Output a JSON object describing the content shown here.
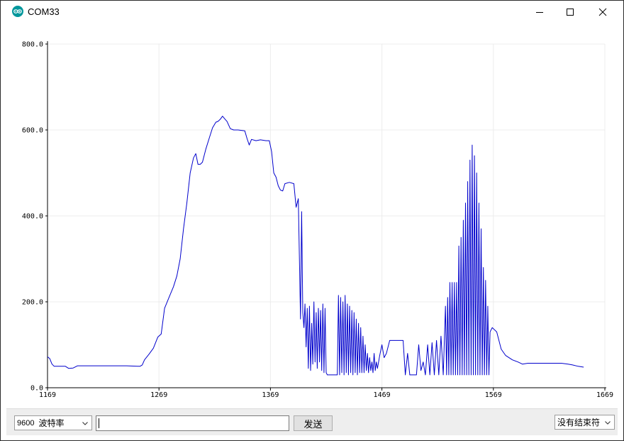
{
  "window": {
    "title": "COM33",
    "app_icon": "arduino-icon",
    "controls": [
      "minimize-icon",
      "maximize-icon",
      "close-icon"
    ]
  },
  "chart_data": {
    "type": "line",
    "title": "",
    "xlabel": "",
    "ylabel": "",
    "xlim": [
      1169,
      1669
    ],
    "ylim": [
      0,
      800
    ],
    "x_ticks": [
      "1169",
      "1269",
      "1369",
      "1469",
      "1569",
      "1669"
    ],
    "y_ticks": [
      "0.0",
      "200.0",
      "400.0",
      "600.0",
      "800.0"
    ],
    "grid": true,
    "series": [
      {
        "color": "#0000cc",
        "points": [
          [
            1169,
            72
          ],
          [
            1171,
            68
          ],
          [
            1173,
            55
          ],
          [
            1175,
            50
          ],
          [
            1178,
            50
          ],
          [
            1185,
            50
          ],
          [
            1188,
            45
          ],
          [
            1192,
            46
          ],
          [
            1196,
            51
          ],
          [
            1210,
            51
          ],
          [
            1240,
            51
          ],
          [
            1250,
            50
          ],
          [
            1252,
            50
          ],
          [
            1254,
            53
          ],
          [
            1256,
            65
          ],
          [
            1260,
            78
          ],
          [
            1264,
            92
          ],
          [
            1268,
            118
          ],
          [
            1271,
            125
          ],
          [
            1274,
            185
          ],
          [
            1278,
            210
          ],
          [
            1282,
            235
          ],
          [
            1285,
            260
          ],
          [
            1288,
            300
          ],
          [
            1291,
            370
          ],
          [
            1294,
            430
          ],
          [
            1297,
            500
          ],
          [
            1300,
            535
          ],
          [
            1302,
            545
          ],
          [
            1304,
            520
          ],
          [
            1306,
            520
          ],
          [
            1308,
            525
          ],
          [
            1311,
            555
          ],
          [
            1314,
            580
          ],
          [
            1317,
            605
          ],
          [
            1320,
            618
          ],
          [
            1322,
            620
          ],
          [
            1324,
            625
          ],
          [
            1326,
            632
          ],
          [
            1328,
            626
          ],
          [
            1330,
            620
          ],
          [
            1333,
            603
          ],
          [
            1336,
            600
          ],
          [
            1340,
            600
          ],
          [
            1346,
            598
          ],
          [
            1348,
            580
          ],
          [
            1350,
            565
          ],
          [
            1352,
            578
          ],
          [
            1356,
            575
          ],
          [
            1360,
            577
          ],
          [
            1365,
            575
          ],
          [
            1368,
            575
          ],
          [
            1370,
            550
          ],
          [
            1372,
            500
          ],
          [
            1374,
            490
          ],
          [
            1376,
            470
          ],
          [
            1378,
            460
          ],
          [
            1380,
            458
          ],
          [
            1382,
            475
          ],
          [
            1386,
            478
          ],
          [
            1390,
            475
          ],
          [
            1392,
            420
          ],
          [
            1394,
            440
          ],
          [
            1396,
            160
          ],
          [
            1397,
            410
          ],
          [
            1398,
            175
          ],
          [
            1399,
            140
          ],
          [
            1400,
            195
          ],
          [
            1401,
            95
          ],
          [
            1402,
            185
          ],
          [
            1403,
            45
          ],
          [
            1404,
            190
          ],
          [
            1405,
            40
          ],
          [
            1406,
            150
          ],
          [
            1407,
            55
          ],
          [
            1408,
            200
          ],
          [
            1409,
            60
          ],
          [
            1410,
            175
          ],
          [
            1411,
            45
          ],
          [
            1412,
            185
          ],
          [
            1413,
            60
          ],
          [
            1414,
            180
          ],
          [
            1415,
            40
          ],
          [
            1416,
            195
          ],
          [
            1417,
            35
          ],
          [
            1418,
            185
          ],
          [
            1419,
            35
          ],
          [
            1420,
            30
          ],
          [
            1425,
            30
          ],
          [
            1429,
            30
          ],
          [
            1430,
            215
          ],
          [
            1431,
            30
          ],
          [
            1432,
            210
          ],
          [
            1433,
            35
          ],
          [
            1434,
            200
          ],
          [
            1435,
            30
          ],
          [
            1436,
            215
          ],
          [
            1437,
            35
          ],
          [
            1438,
            195
          ],
          [
            1439,
            30
          ],
          [
            1440,
            190
          ],
          [
            1441,
            35
          ],
          [
            1442,
            180
          ],
          [
            1443,
            30
          ],
          [
            1444,
            175
          ],
          [
            1445,
            35
          ],
          [
            1446,
            160
          ],
          [
            1447,
            30
          ],
          [
            1448,
            150
          ],
          [
            1449,
            35
          ],
          [
            1450,
            140
          ],
          [
            1451,
            35
          ],
          [
            1452,
            120
          ],
          [
            1453,
            35
          ],
          [
            1454,
            100
          ],
          [
            1455,
            40
          ],
          [
            1456,
            80
          ],
          [
            1457,
            35
          ],
          [
            1458,
            70
          ],
          [
            1459,
            40
          ],
          [
            1460,
            60
          ],
          [
            1461,
            35
          ],
          [
            1462,
            80
          ],
          [
            1463,
            40
          ],
          [
            1464,
            60
          ],
          [
            1465,
            45
          ],
          [
            1467,
            75
          ],
          [
            1469,
            100
          ],
          [
            1471,
            70
          ],
          [
            1473,
            80
          ],
          [
            1476,
            110
          ],
          [
            1480,
            110
          ],
          [
            1488,
            110
          ],
          [
            1490,
            30
          ],
          [
            1492,
            80
          ],
          [
            1494,
            30
          ],
          [
            1496,
            30
          ],
          [
            1500,
            30
          ],
          [
            1502,
            100
          ],
          [
            1504,
            40
          ],
          [
            1506,
            60
          ],
          [
            1508,
            30
          ],
          [
            1510,
            100
          ],
          [
            1512,
            30
          ],
          [
            1514,
            105
          ],
          [
            1516,
            30
          ],
          [
            1518,
            110
          ],
          [
            1520,
            30
          ],
          [
            1522,
            120
          ],
          [
            1524,
            30
          ],
          [
            1526,
            190
          ],
          [
            1527,
            30
          ],
          [
            1528,
            210
          ],
          [
            1529,
            30
          ],
          [
            1530,
            245
          ],
          [
            1531,
            30
          ],
          [
            1532,
            245
          ],
          [
            1533,
            30
          ],
          [
            1534,
            245
          ],
          [
            1535,
            30
          ],
          [
            1536,
            245
          ],
          [
            1537,
            30
          ],
          [
            1538,
            330
          ],
          [
            1539,
            30
          ],
          [
            1540,
            350
          ],
          [
            1541,
            30
          ],
          [
            1542,
            390
          ],
          [
            1543,
            30
          ],
          [
            1544,
            430
          ],
          [
            1545,
            30
          ],
          [
            1546,
            480
          ],
          [
            1547,
            30
          ],
          [
            1548,
            530
          ],
          [
            1549,
            30
          ],
          [
            1550,
            565
          ],
          [
            1551,
            30
          ],
          [
            1552,
            540
          ],
          [
            1553,
            30
          ],
          [
            1554,
            500
          ],
          [
            1555,
            30
          ],
          [
            1556,
            430
          ],
          [
            1557,
            30
          ],
          [
            1558,
            370
          ],
          [
            1559,
            30
          ],
          [
            1560,
            280
          ],
          [
            1561,
            30
          ],
          [
            1562,
            250
          ],
          [
            1563,
            30
          ],
          [
            1564,
            190
          ],
          [
            1565,
            30
          ],
          [
            1566,
            130
          ],
          [
            1568,
            140
          ],
          [
            1572,
            130
          ],
          [
            1576,
            90
          ],
          [
            1580,
            75
          ],
          [
            1586,
            65
          ],
          [
            1591,
            60
          ],
          [
            1595,
            55
          ],
          [
            1600,
            57
          ],
          [
            1620,
            57
          ],
          [
            1630,
            57
          ],
          [
            1636,
            55
          ],
          [
            1640,
            53
          ],
          [
            1645,
            50
          ],
          [
            1650,
            48
          ]
        ]
      }
    ]
  },
  "bottom_bar": {
    "baud_rate": {
      "value": "9600",
      "label": "波特率"
    },
    "message_input": {
      "value": "",
      "placeholder": ""
    },
    "send_label": "发送",
    "line_ending": "没有结束符"
  }
}
